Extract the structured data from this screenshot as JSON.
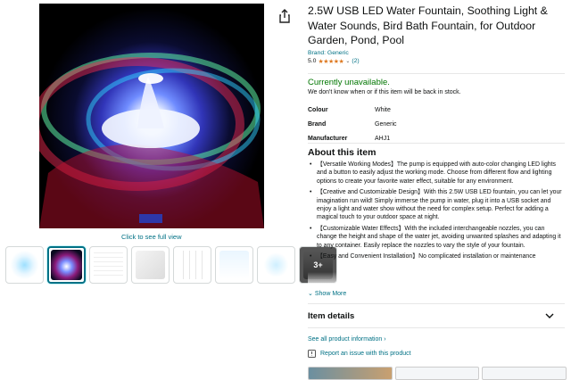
{
  "gallery": {
    "see_full_view": "Click to see full view",
    "more_label": "3+"
  },
  "product": {
    "title": "2.5W USB LED Water Fountain, Soothing Light & Water Sounds, Bird Bath Fountain, for Outdoor Garden, Pond, Pool",
    "brand_link": "Brand: Generic",
    "rating_value": "5.0",
    "rating_stars": "★★★★★",
    "rating_count": "(2)"
  },
  "availability": {
    "status": "Currently unavailable.",
    "note": "We don't know when or if this item will be back in stock."
  },
  "specs": [
    {
      "key": "Colour",
      "value": "White"
    },
    {
      "key": "Brand",
      "value": "Generic"
    },
    {
      "key": "Manufacturer",
      "value": "AHJ1"
    }
  ],
  "about": {
    "heading": "About this item",
    "bullets": [
      "【Versatile Working Modes】The pump is equipped with auto-color changing LED lights and a button to easily adjust the working mode. Choose from different flow and lighting options to create your favorite water effect, suitable for any environment.",
      "【Creative and Customizable Design】With this 2.5W USB LED fountain, you can let your imagination run wild! Simply immerse the pump in water, plug it into a USB socket and enjoy a light and water show without the need for complex setup. Perfect for adding a magical touch to your outdoor space at night.",
      "【Customizable Water Effects】With the included interchangeable nozzles, you can change the height and shape of the water jet, avoiding unwanted splashes and adapting it to any container. Easily replace the nozzles to vary the style of your fountain.",
      "【Easy and Convenient Installation】No complicated installation or maintenance"
    ],
    "show_more": "Show More"
  },
  "item_details": {
    "title": "Item details",
    "all_info_link": "See all product information",
    "report_link": "Report an issue with this product"
  },
  "colors": {
    "link": "#007185",
    "in_stock_green": "#007600",
    "star": "#de7921"
  }
}
